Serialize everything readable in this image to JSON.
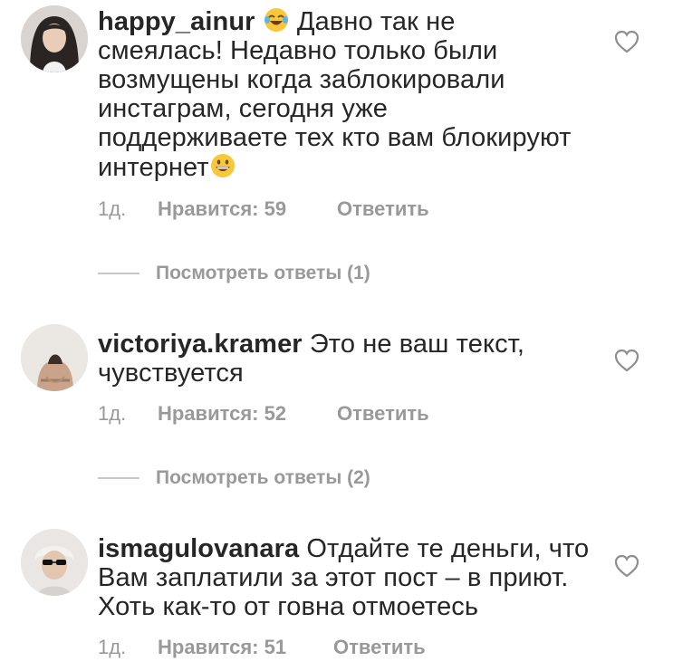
{
  "comments": [
    {
      "username": "happy_ainur",
      "text_lines": [
        "Давно так не",
        "смеялась! Недавно только были",
        "возмущены когда заблокировали",
        "инстаграм, сегодня уже",
        "поддерживаете тех кто вам блокируют",
        "интернет"
      ],
      "emojis": [
        "tears-of-joy-emoji",
        "grinning-emoji"
      ],
      "time": "1д.",
      "likes": "Нравится: 59",
      "reply": "Ответить",
      "view_replies": "Посмотреть ответы (1)"
    },
    {
      "username": "victoriya.kramer",
      "text_lines": [
        "Это не ваш текст,",
        "чувствуется"
      ],
      "time": "1д.",
      "likes": "Нравится: 52",
      "reply": "Ответить",
      "view_replies": "Посмотреть ответы (2)"
    },
    {
      "username": "ismagulovanara",
      "text_lines": [
        "Отдайте те деньги, что",
        "Вам заплатили за этот пост – в приют.",
        "Хоть как-то от говна отмоетесь"
      ],
      "time": "1д.",
      "likes": "Нравится: 51",
      "reply": "Ответить"
    }
  ],
  "colors": {
    "text": "#262626",
    "secondary": "#999999",
    "divider": "#c7c7c7"
  }
}
